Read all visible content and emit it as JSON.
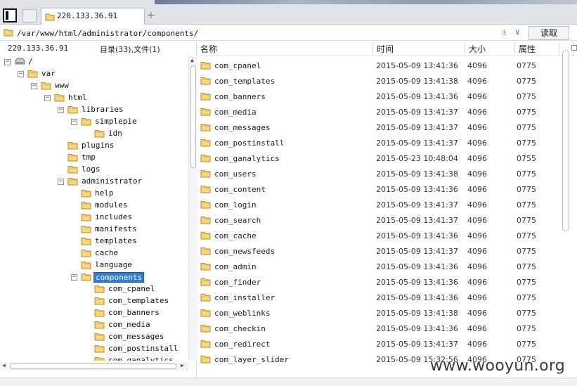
{
  "tabbar": {
    "active_tab_label": "220.133.36.91",
    "new_tab_icon": "plus-icon",
    "colors": {
      "bg": "#dfe3e8",
      "folder": "#f0c75e"
    }
  },
  "pathbar": {
    "path_value": "/var/www/html/administrator/components/",
    "pm_symbol": "±",
    "dropdown_arrow": "∨",
    "read_button_label": "读取"
  },
  "left_panel": {
    "host_label": "220.133.36.91",
    "count_label": "目录(33),文件(1)",
    "tree": [
      {
        "label": "/",
        "depth": 0,
        "expander": "−",
        "icon": "drive-icon"
      },
      {
        "label": "var",
        "depth": 1,
        "expander": "−",
        "icon": "folder-icon"
      },
      {
        "label": "www",
        "depth": 2,
        "expander": "−",
        "icon": "folder-icon"
      },
      {
        "label": "html",
        "depth": 3,
        "expander": "−",
        "icon": "folder-icon"
      },
      {
        "label": "libraries",
        "depth": 4,
        "expander": "−",
        "icon": "folder-icon"
      },
      {
        "label": "simplepie",
        "depth": 5,
        "expander": "−",
        "icon": "folder-icon"
      },
      {
        "label": "idn",
        "depth": 6,
        "expander": "",
        "icon": "folder-icon"
      },
      {
        "label": "plugins",
        "depth": 4,
        "expander": "",
        "icon": "folder-icon"
      },
      {
        "label": "tmp",
        "depth": 4,
        "expander": "",
        "icon": "folder-icon"
      },
      {
        "label": "logs",
        "depth": 4,
        "expander": "",
        "icon": "folder-icon"
      },
      {
        "label": "administrator",
        "depth": 4,
        "expander": "−",
        "icon": "folder-icon"
      },
      {
        "label": "help",
        "depth": 5,
        "expander": "",
        "icon": "folder-icon"
      },
      {
        "label": "modules",
        "depth": 5,
        "expander": "",
        "icon": "folder-icon"
      },
      {
        "label": "includes",
        "depth": 5,
        "expander": "",
        "icon": "folder-icon"
      },
      {
        "label": "manifests",
        "depth": 5,
        "expander": "",
        "icon": "folder-icon"
      },
      {
        "label": "templates",
        "depth": 5,
        "expander": "",
        "icon": "folder-icon"
      },
      {
        "label": "cache",
        "depth": 5,
        "expander": "",
        "icon": "folder-icon"
      },
      {
        "label": "language",
        "depth": 5,
        "expander": "",
        "icon": "folder-icon"
      },
      {
        "label": "components",
        "depth": 5,
        "expander": "−",
        "icon": "folder-icon",
        "selected": true
      },
      {
        "label": "com_cpanel",
        "depth": 6,
        "expander": "",
        "icon": "folder-icon"
      },
      {
        "label": "com_templates",
        "depth": 6,
        "expander": "",
        "icon": "folder-icon"
      },
      {
        "label": "com_banners",
        "depth": 6,
        "expander": "",
        "icon": "folder-icon"
      },
      {
        "label": "com_media",
        "depth": 6,
        "expander": "",
        "icon": "folder-icon"
      },
      {
        "label": "com_messages",
        "depth": 6,
        "expander": "",
        "icon": "folder-icon"
      },
      {
        "label": "com_postinstall",
        "depth": 6,
        "expander": "",
        "icon": "folder-icon"
      },
      {
        "label": "com_ganalytics",
        "depth": 6,
        "expander": "",
        "icon": "folder-icon"
      }
    ]
  },
  "file_list": {
    "columns": {
      "name": "名称",
      "time": "时间",
      "size": "大小",
      "perm": "属性"
    },
    "rows": [
      {
        "name": "com_cpanel",
        "time": "2015-05-09 13:41:36",
        "size": "4096",
        "perm": "0775"
      },
      {
        "name": "com_templates",
        "time": "2015-05-09 13:41:38",
        "size": "4096",
        "perm": "0775"
      },
      {
        "name": "com_banners",
        "time": "2015-05-09 13:41:36",
        "size": "4096",
        "perm": "0775"
      },
      {
        "name": "com_media",
        "time": "2015-05-09 13:41:37",
        "size": "4096",
        "perm": "0775"
      },
      {
        "name": "com_messages",
        "time": "2015-05-09 13:41:37",
        "size": "4096",
        "perm": "0775"
      },
      {
        "name": "com_postinstall",
        "time": "2015-05-09 13:41:37",
        "size": "4096",
        "perm": "0775"
      },
      {
        "name": "com_ganalytics",
        "time": "2015-05-23 10:48:04",
        "size": "4096",
        "perm": "0755"
      },
      {
        "name": "com_users",
        "time": "2015-05-09 13:41:38",
        "size": "4096",
        "perm": "0775"
      },
      {
        "name": "com_content",
        "time": "2015-05-09 13:41:36",
        "size": "4096",
        "perm": "0775"
      },
      {
        "name": "com_login",
        "time": "2015-05-09 13:41:37",
        "size": "4096",
        "perm": "0775"
      },
      {
        "name": "com_search",
        "time": "2015-05-09 13:41:37",
        "size": "4096",
        "perm": "0775"
      },
      {
        "name": "com_cache",
        "time": "2015-05-09 13:41:36",
        "size": "4096",
        "perm": "0775"
      },
      {
        "name": "com_newsfeeds",
        "time": "2015-05-09 13:41:37",
        "size": "4096",
        "perm": "0775"
      },
      {
        "name": "com_admin",
        "time": "2015-05-09 13:41:36",
        "size": "4096",
        "perm": "0775"
      },
      {
        "name": "com_finder",
        "time": "2015-05-09 13:41:36",
        "size": "4096",
        "perm": "0775"
      },
      {
        "name": "com_installer",
        "time": "2015-05-09 13:41:36",
        "size": "4096",
        "perm": "0775"
      },
      {
        "name": "com_weblinks",
        "time": "2015-05-09 13:41:38",
        "size": "4096",
        "perm": "0775"
      },
      {
        "name": "com_checkin",
        "time": "2015-05-09 13:41:36",
        "size": "4096",
        "perm": "0775"
      },
      {
        "name": "com_redirect",
        "time": "2015-05-09 13:41:37",
        "size": "4096",
        "perm": "0775"
      },
      {
        "name": "com_layer_slider",
        "time": "2015-05-09 15:32:56",
        "size": "4096",
        "perm": "0775"
      }
    ]
  },
  "watermark": "www.wooyun.org"
}
